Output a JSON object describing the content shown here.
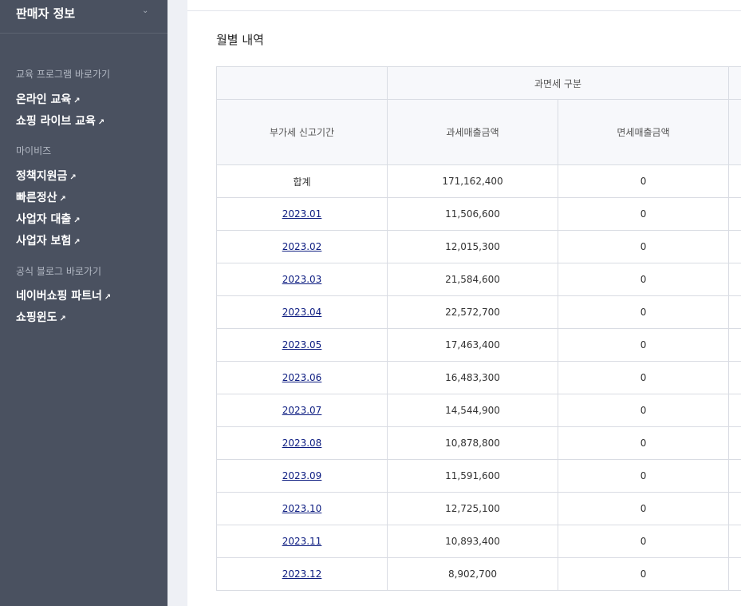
{
  "sidebar": {
    "header": {
      "title": "판매자 정보",
      "chevron_icon": "chevron-down-icon"
    },
    "sections": [
      {
        "title": "교육 프로그램 바로가기",
        "links": [
          "온라인 교육",
          "쇼핑 라이브 교육"
        ]
      },
      {
        "title": "마이비즈",
        "links": [
          "정책지원금",
          "빠른정산",
          "사업자 대출",
          "사업자 보험"
        ]
      },
      {
        "title": "공식 블로그 바로가기",
        "links": [
          "네이버쇼핑 파트너",
          "쇼핑윈도"
        ]
      }
    ],
    "external_arrow": "↗"
  },
  "main": {
    "section_title": "월별 내역",
    "table": {
      "group_header": "과면세 구분",
      "columns": [
        "부가세 신고기간",
        "과세매출금액",
        "면세매출금액"
      ],
      "total_row": {
        "period": "합계",
        "taxable": "171,162,400",
        "exempt": "0"
      },
      "rows": [
        {
          "period": "2023.01",
          "taxable": "11,506,600",
          "exempt": "0"
        },
        {
          "period": "2023.02",
          "taxable": "12,015,300",
          "exempt": "0"
        },
        {
          "period": "2023.03",
          "taxable": "21,584,600",
          "exempt": "0"
        },
        {
          "period": "2023.04",
          "taxable": "22,572,700",
          "exempt": "0"
        },
        {
          "period": "2023.05",
          "taxable": "17,463,400",
          "exempt": "0"
        },
        {
          "period": "2023.06",
          "taxable": "16,483,300",
          "exempt": "0"
        },
        {
          "period": "2023.07",
          "taxable": "14,544,900",
          "exempt": "0"
        },
        {
          "period": "2023.08",
          "taxable": "10,878,800",
          "exempt": "0"
        },
        {
          "period": "2023.09",
          "taxable": "11,591,600",
          "exempt": "0"
        },
        {
          "period": "2023.10",
          "taxable": "12,725,100",
          "exempt": "0"
        },
        {
          "period": "2023.11",
          "taxable": "10,893,400",
          "exempt": "0"
        },
        {
          "period": "2023.12",
          "taxable": "8,902,700",
          "exempt": "0"
        }
      ]
    }
  },
  "colors": {
    "sidebar_bg": "#4a5160",
    "link_color": "#0b1b80",
    "header_bg": "#f7f8fb"
  }
}
